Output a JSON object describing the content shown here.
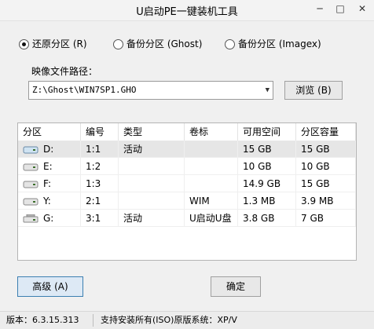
{
  "window": {
    "title": "U启动PE一键装机工具",
    "minimize": "─",
    "maximize": "□",
    "close": "✕"
  },
  "options": [
    {
      "label": "还原分区 (R)",
      "checked": true
    },
    {
      "label": "备份分区 (Ghost)",
      "checked": false
    },
    {
      "label": "备份分区 (Imagex)",
      "checked": false
    }
  ],
  "image_path": {
    "label": "映像文件路径：",
    "value": "Z:\\Ghost\\WIN7SP1.GHO",
    "browse": "浏览 (B)"
  },
  "table": {
    "columns": [
      "分区",
      "编号",
      "类型",
      "卷标",
      "可用空间",
      "分区容量"
    ],
    "rows": [
      {
        "drive": "D:",
        "number": "1:1",
        "type": "活动",
        "label": "",
        "free": "15 GB",
        "capacity": "15 GB",
        "selected": true,
        "icon": "drive-icon"
      },
      {
        "drive": "E:",
        "number": "1:2",
        "type": "",
        "label": "",
        "free": "10 GB",
        "capacity": "10 GB",
        "selected": false,
        "icon": "drive-icon"
      },
      {
        "drive": "F:",
        "number": "1:3",
        "type": "",
        "label": "",
        "free": "14.9 GB",
        "capacity": "15 GB",
        "selected": false,
        "icon": "drive-icon"
      },
      {
        "drive": "Y:",
        "number": "2:1",
        "type": "",
        "label": "WIM",
        "free": "1.3 MB",
        "capacity": "3.9 MB",
        "selected": false,
        "icon": "drive-icon"
      },
      {
        "drive": "G:",
        "number": "3:1",
        "type": "活动",
        "label": "U启动U盘",
        "free": "3.8 GB",
        "capacity": "7 GB",
        "selected": false,
        "icon": "usb-drive-icon"
      }
    ]
  },
  "buttons": {
    "advanced": "高级 (A)",
    "ok": "确定"
  },
  "status": {
    "version": "版本：6.3.15.313",
    "support": "支持安装所有(ISO)原版系统：XP/V"
  }
}
